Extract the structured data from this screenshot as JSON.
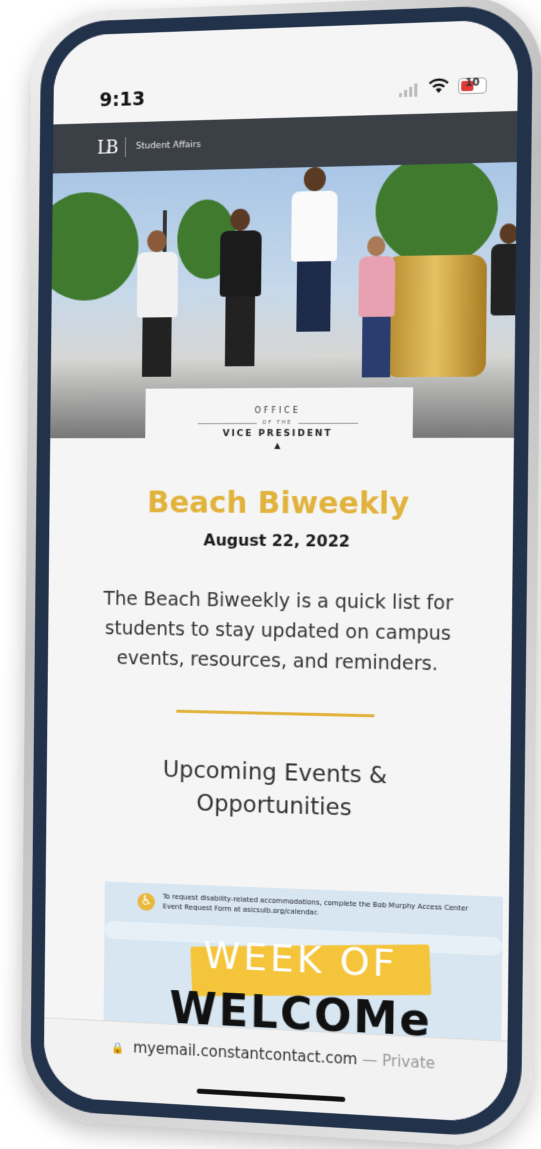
{
  "status": {
    "time": "9:13",
    "battery": "10"
  },
  "header": {
    "title": "Student Affairs"
  },
  "office": {
    "top": "OFFICE",
    "mid": "OF THE",
    "bottom": "VICE PRESIDENT"
  },
  "newsletter": {
    "title": "Beach Biweekly",
    "date": "August 22, 2022",
    "intro": "The Beach Biweekly is a quick list for students to stay updated on campus events, resources, and reminders.",
    "section_heading": "Upcoming Events & Opportunities"
  },
  "banner": {
    "access_note": "To request disability-related accommodations, complete the Bob Murphy Access Center Event Request Form at asicsulb.org/calendar.",
    "week_of": "WEEK OF",
    "welcome": "WELCOMe"
  },
  "url_bar": {
    "domain": "myemail.constantcontact.com",
    "suffix": "— Private"
  },
  "colors": {
    "accent": "#e2b33c",
    "header_bg": "#3b3f46",
    "bezel": "#22324a"
  }
}
